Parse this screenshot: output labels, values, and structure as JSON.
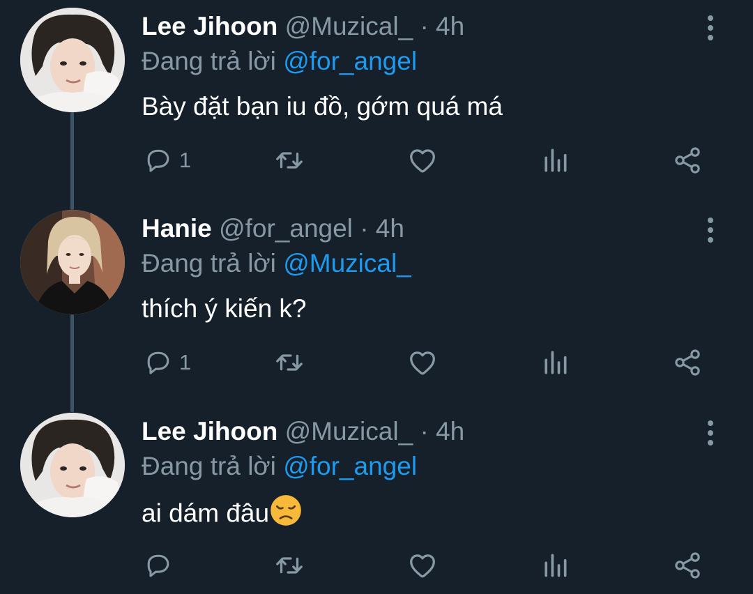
{
  "colors": {
    "background": "#15202b",
    "secondary_text": "#8899a6",
    "link": "#1d9bf0",
    "thread_line": "#3d5466"
  },
  "tweets": [
    {
      "name": "Lee Jihoon",
      "handle": "@Muzical_",
      "separator": "·",
      "time": "4h",
      "reply_prefix": "Đang trả lời",
      "reply_to": "@for_angel",
      "text": "Bày đặt bạn iu đồ, gớm quá má",
      "reply_count": "1",
      "avatar_icon": "avatar-dark-hair-photo"
    },
    {
      "name": "Hanie",
      "handle": "@for_angel",
      "separator": "·",
      "time": "4h",
      "reply_prefix": "Đang trả lời",
      "reply_to": "@Muzical_",
      "text": "thích ý kiến k?",
      "reply_count": "1",
      "avatar_icon": "avatar-blonde-hair-photo"
    },
    {
      "name": "Lee Jihoon",
      "handle": "@Muzical_",
      "separator": "·",
      "time": "4h",
      "reply_prefix": "Đang trả lời",
      "reply_to": "@for_angel",
      "text": "ai dám đâu",
      "reply_count": "",
      "emoji": "disappointed-face-emoji",
      "avatar_icon": "avatar-dark-hair-photo"
    }
  ]
}
